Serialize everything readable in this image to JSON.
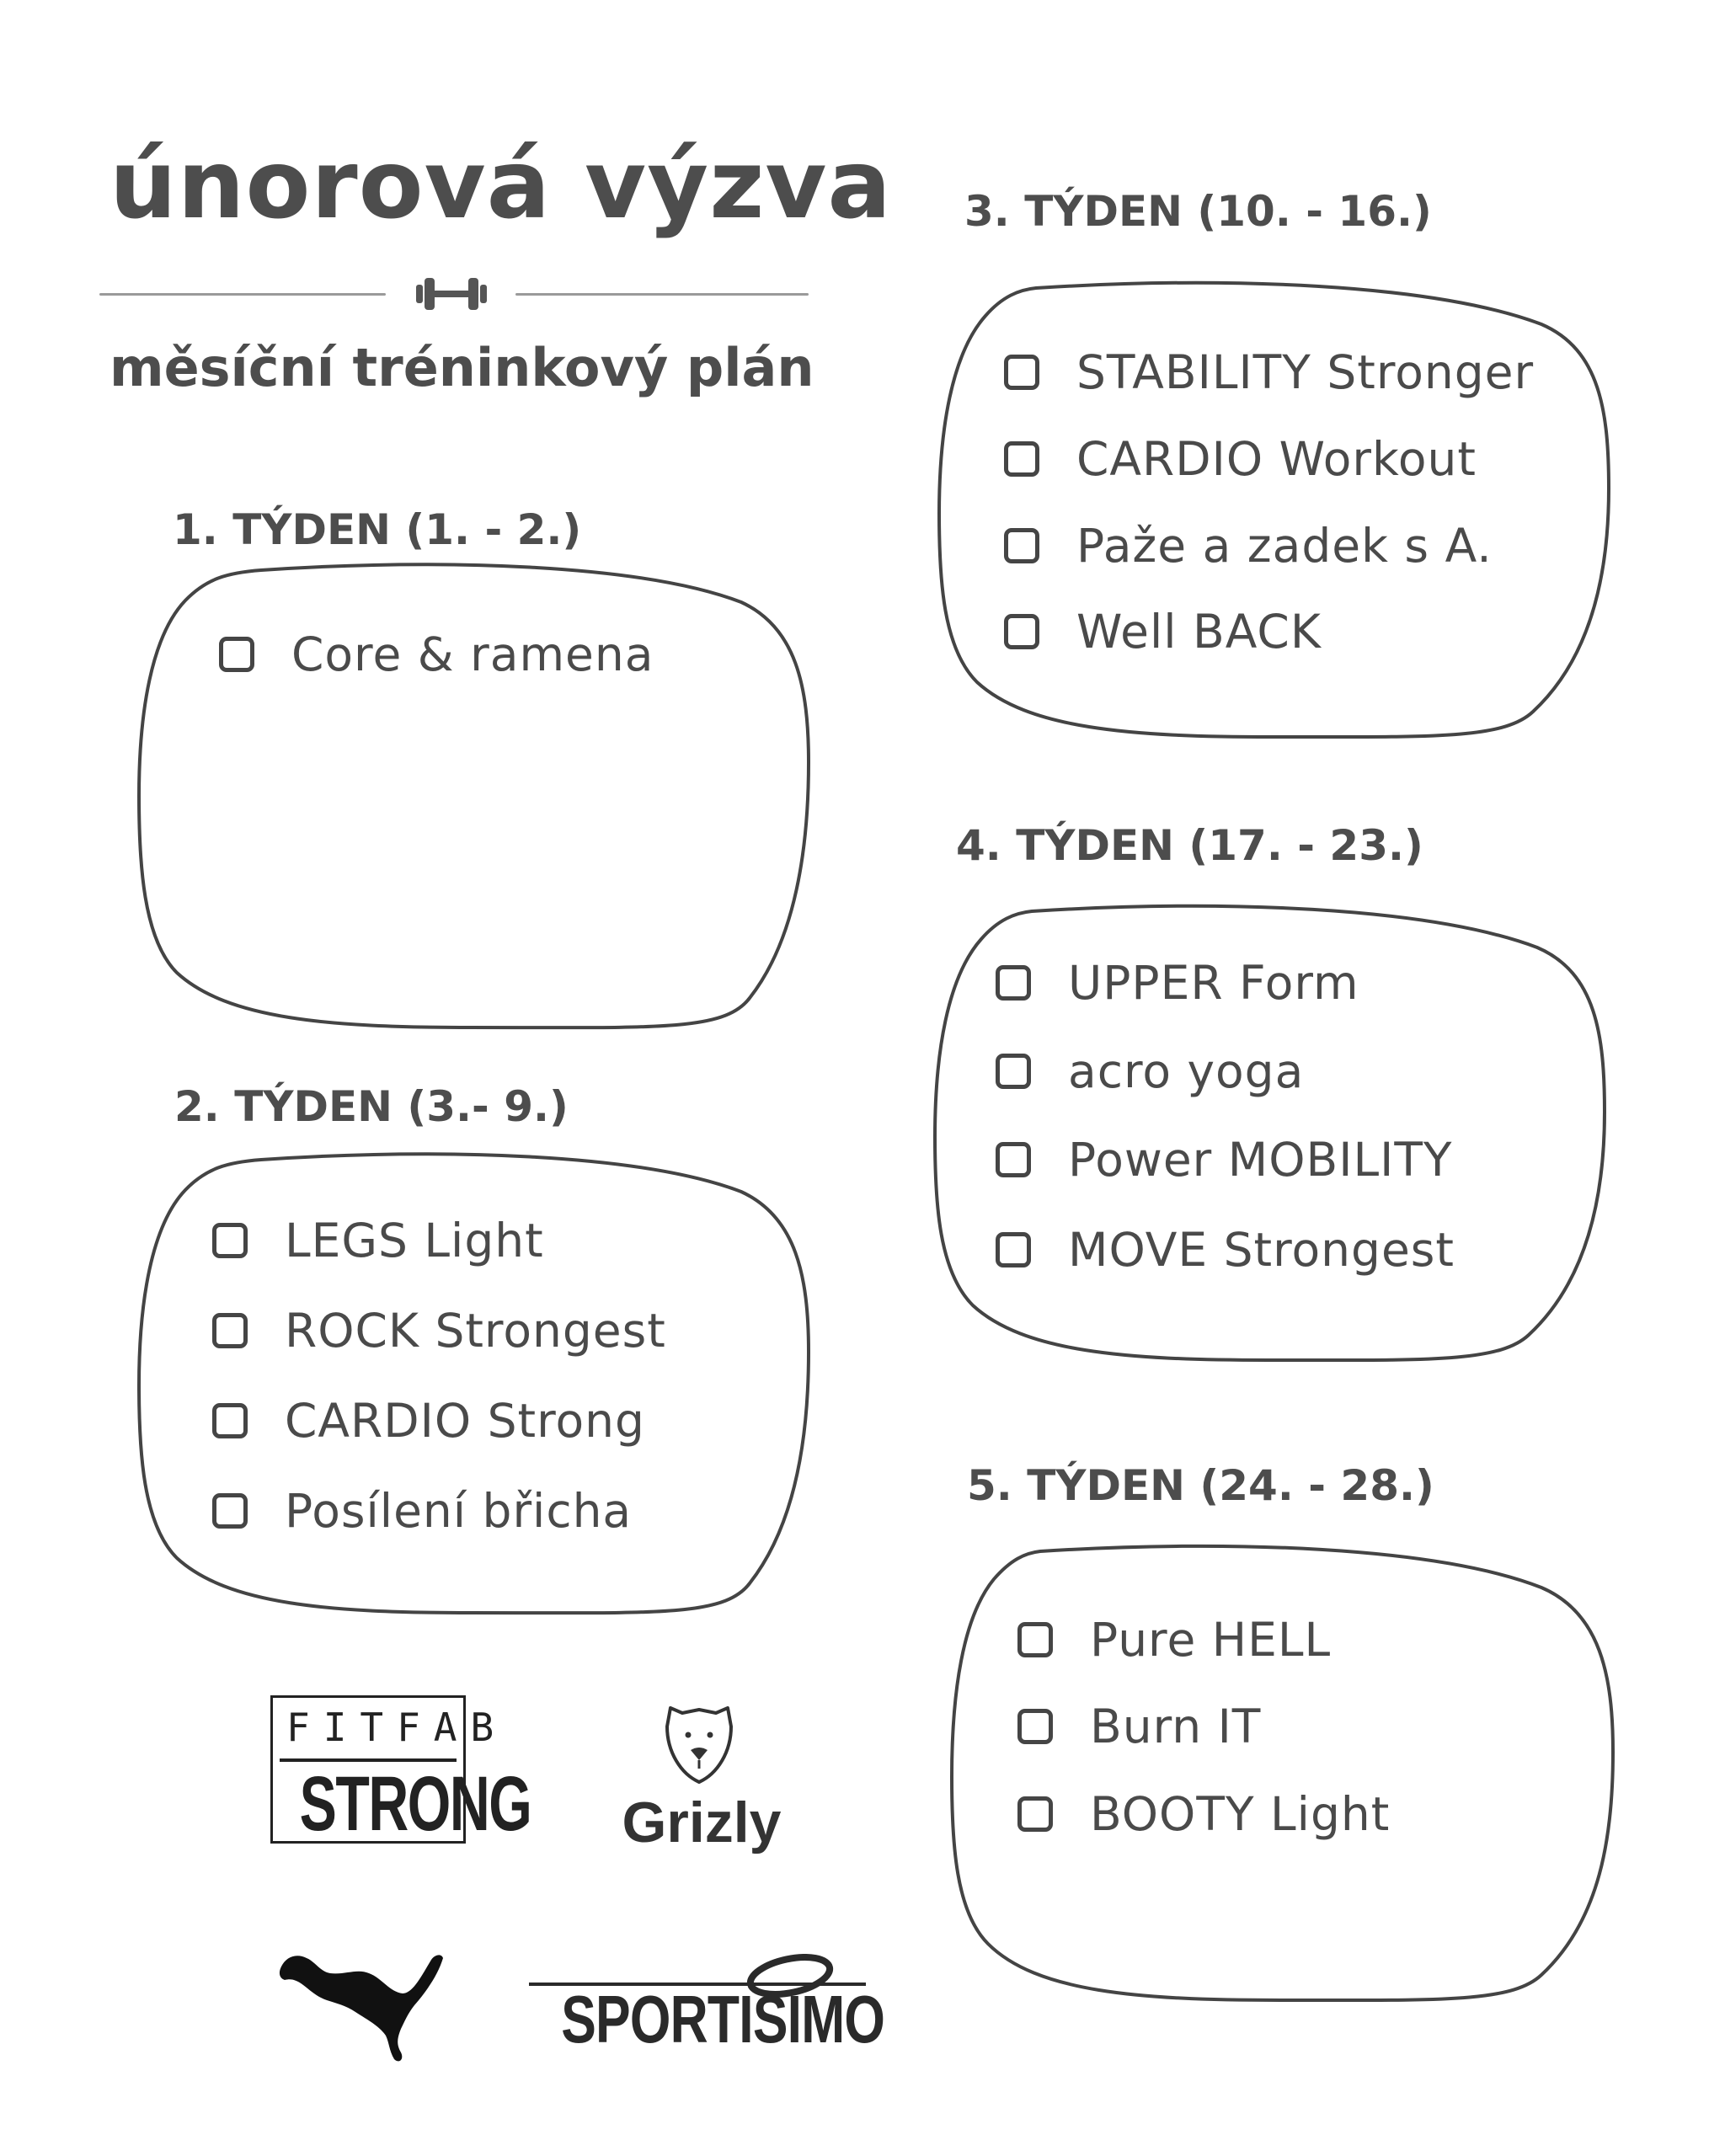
{
  "header": {
    "title": "únorová výzva",
    "subtitle": "měsíční tréninkový plán",
    "divider_icon": "dumbbell-icon"
  },
  "weeks": [
    {
      "heading": "1.  TÝDEN (1. - 2.)",
      "tasks": [
        "Core & ramena"
      ]
    },
    {
      "heading": "2.  TÝDEN (3.- 9.)",
      "tasks": [
        "LEGS Light",
        "ROCK Strongest",
        "CARDIO Strong",
        "Posílení břicha"
      ]
    },
    {
      "heading": "3.  TÝDEN (10. - 16.)",
      "tasks": [
        "STABILITY Stronger",
        "CARDIO Workout",
        "Paže a zadek s A.",
        "Well BACK"
      ]
    },
    {
      "heading": "4.  TÝDEN (17. - 23.)",
      "tasks": [
        "UPPER Form",
        "acro yoga",
        "Power MOBILITY",
        "MOVE Strongest"
      ]
    },
    {
      "heading": "5.  TÝDEN (24. - 28.)",
      "tasks": [
        "Pure HELL",
        "Burn IT",
        "BOOTY Light"
      ]
    }
  ],
  "logos": {
    "fitfab_top": "FITFAB",
    "fitfab_bottom": "STRONG",
    "grizly": "Grizly",
    "puma": "puma-logo",
    "sportisimo": "SPORTISIMO"
  },
  "colors": {
    "text": "#4a4a4a",
    "stroke": "#444444",
    "background": "#ffffff"
  }
}
